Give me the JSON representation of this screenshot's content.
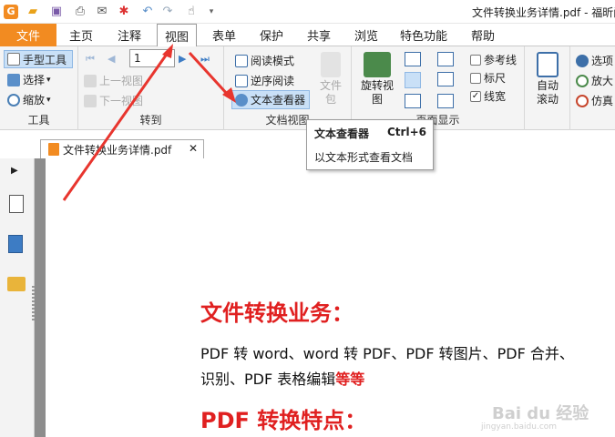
{
  "app": {
    "title": "文件转换业务详情.pdf - 福昕阅"
  },
  "menubar": {
    "file": "文件",
    "tabs": [
      "主页",
      "注释",
      "视图",
      "表单",
      "保护",
      "共享",
      "浏览",
      "特色功能",
      "帮助"
    ],
    "active_tab": "视图"
  },
  "ribbon": {
    "tools": {
      "hand": "手型工具",
      "select": "选择",
      "zoom": "缩放",
      "label": "工具"
    },
    "goto": {
      "page_value": "1",
      "prev_view": "上一视图",
      "next_view": "下一视图",
      "label": "转到"
    },
    "docview": {
      "read_mode": "阅读模式",
      "reverse_read": "逆序阅读",
      "text_viewer": "文本查看器",
      "file_pkg": "文件包",
      "label": "文档视图"
    },
    "pagedisplay": {
      "rotate": "旋转视图",
      "guides": "参考线",
      "ruler": "标尺",
      "line_weight": "线宽",
      "label": "页面显示"
    },
    "auto_scroll": "自动滚动",
    "right": {
      "select": "选项",
      "magnify": "放大",
      "emulate": "仿真"
    }
  },
  "tooltip": {
    "title": "文本查看器",
    "shortcut": "Ctrl+6",
    "desc": "以文本形式查看文档"
  },
  "doc_tab": {
    "name": "文件转换业务详情.pdf"
  },
  "document": {
    "heading1": "文件转换业务：",
    "para1": "PDF 转 word、word 转 PDF、PDF 转图片、PDF 合并、",
    "para2": "识别、PDF 表格编辑",
    "para2_red": "等等",
    "heading2": "PDF 转换特点："
  },
  "watermark": {
    "brand": "Bai du 经验",
    "url": "jingyan.baidu.com"
  },
  "colors": {
    "file_tab": "#f28b21",
    "accent_red": "#e02020",
    "arrow": "#e8352e",
    "highlight": "#c9e0f7"
  }
}
